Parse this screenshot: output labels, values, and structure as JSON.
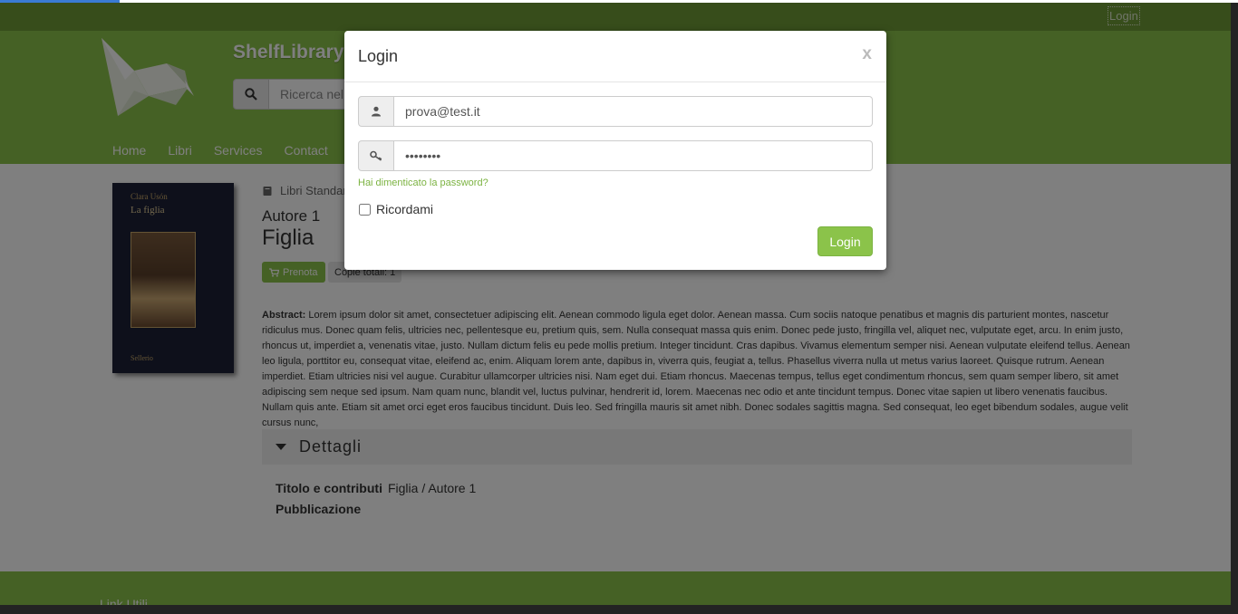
{
  "topbar": {
    "login_label": "Login"
  },
  "header": {
    "site_name": "ShelfLibrary",
    "search_placeholder": "Ricerca nel catalogo",
    "nav": [
      "Home",
      "Libri",
      "Services",
      "Contact"
    ]
  },
  "book": {
    "cover_author": "Clara Usón",
    "cover_title": "La figlia",
    "cover_publisher": "Sellerio",
    "breadcrumb": "Libri Standard",
    "author": "Autore 1",
    "title": "Figlia",
    "reserve_label": "Prenota",
    "copies_label": "Copie totali: 1",
    "abstract_label": "Abstract:",
    "abstract_text": "Lorem ipsum dolor sit amet, consectetuer adipiscing elit. Aenean commodo ligula eget dolor. Aenean massa. Cum sociis natoque penatibus et magnis dis parturient montes, nascetur ridiculus mus. Donec quam felis, ultricies nec, pellentesque eu, pretium quis, sem. Nulla consequat massa quis enim. Donec pede justo, fringilla vel, aliquet nec, vulputate eget, arcu. In enim justo, rhoncus ut, imperdiet a, venenatis vitae, justo. Nullam dictum felis eu pede mollis pretium. Integer tincidunt. Cras dapibus. Vivamus elementum semper nisi. Aenean vulputate eleifend tellus. Aenean leo ligula, porttitor eu, consequat vitae, eleifend ac, enim. Aliquam lorem ante, dapibus in, viverra quis, feugiat a, tellus. Phasellus viverra nulla ut metus varius laoreet. Quisque rutrum. Aenean imperdiet. Etiam ultricies nisi vel augue. Curabitur ullamcorper ultricies nisi. Nam eget dui. Etiam rhoncus. Maecenas tempus, tellus eget condimentum rhoncus, sem quam semper libero, sit amet adipiscing sem neque sed ipsum. Nam quam nunc, blandit vel, luctus pulvinar, hendrerit id, lorem. Maecenas nec odio et ante tincidunt tempus. Donec vitae sapien ut libero venenatis faucibus. Nullam quis ante. Etiam sit amet orci eget eros faucibus tincidunt. Duis leo. Sed fringilla mauris sit amet nibh. Donec sodales sagittis magna. Sed consequat, leo eget bibendum sodales, augue velit cursus nunc,",
    "details_title": "Dettagli",
    "details": [
      {
        "label": "Titolo e contributi",
        "value": "Figlia / Autore 1"
      },
      {
        "label": "Pubblicazione",
        "value": ""
      }
    ]
  },
  "footer": {
    "heading": "Link Utili"
  },
  "modal": {
    "title": "Login",
    "close_label": "x",
    "email_value": "prova@test.it",
    "password_value": "••••••••",
    "forgot_label": "Hai dimenticato la password?",
    "remember_label": "Ricordami",
    "submit_label": "Login"
  },
  "colors": {
    "brand_green": "#8bc34a",
    "topbar_green": "#6e9a36",
    "link_green": "#7cb342"
  },
  "icons": [
    "user-icon",
    "key-icon",
    "search-icon",
    "book-icon",
    "cart-icon",
    "caret-down-icon"
  ]
}
